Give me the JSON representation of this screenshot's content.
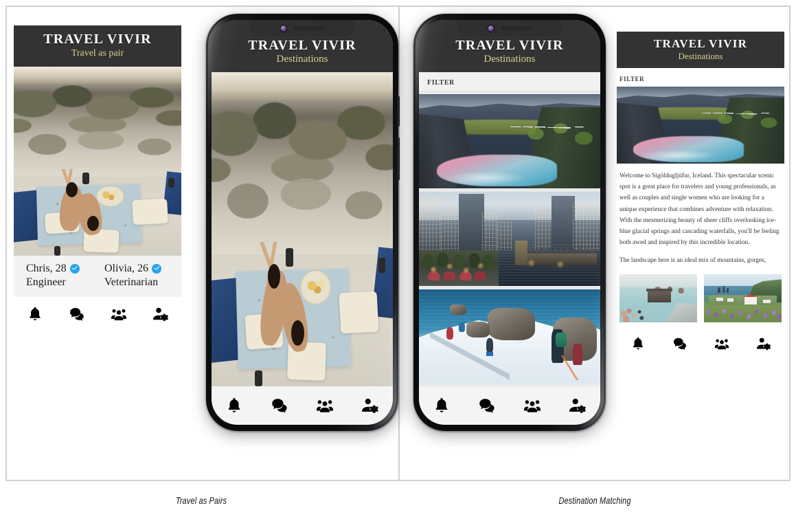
{
  "app": {
    "title": "TRAVEL VIVIR",
    "subtitle_pair": "Travel as pair",
    "subtitle_destinations": "Destinations",
    "filter_label": "FILTER",
    "brand_accent": "#d8cf8e",
    "header_bg": "#333333",
    "verified_color": "#2aa3ef"
  },
  "captions": {
    "left": "Travel as Pairs",
    "right": "Destination Matching"
  },
  "profiles": [
    {
      "name": "Chris, 28",
      "job": "Engineer",
      "verified": true
    },
    {
      "name": "Olivia, 26",
      "job": "Veterinarian",
      "verified": true
    }
  ],
  "nav": {
    "items": [
      {
        "icon": "bell-icon",
        "label": "Notifications"
      },
      {
        "icon": "chat-bubbles-icon",
        "label": "Messages"
      },
      {
        "icon": "people-group-icon",
        "label": "Groups"
      },
      {
        "icon": "person-settings-icon",
        "label": "Profile settings"
      }
    ]
  },
  "photos": {
    "couple_picnic": "Aerial view of a couple on a picnic blanket on a stone terrace by the sea",
    "canyon": "Sigoldugljufur canyon with waterfalls and a pink-teal river",
    "city_riverwalk": "City riverwalk with illuminated skyscrapers at dusk",
    "snow_ridge": "Mountaineers ascending a snowy ridge above a blue lake",
    "blue_lagoon": "Geothermal blue lagoon spa with bathers",
    "vik_lupines": "Coastal village church surrounded by purple lupine fields"
  },
  "feed": {
    "cards": [
      {
        "name": "canyon"
      },
      {
        "name": "city_riverwalk"
      },
      {
        "name": "snow_ridge"
      }
    ]
  },
  "detail": {
    "paragraph1": "Welcome to Sigöldugljúfur, Iceland. This spectacular scenic spot is a great place for travelers and young professionals, as well as couples and single women who are looking for a unique experience that combines adventure with relaxation. With the mesmerizing beauty of sheer cliffs overlooking ice-blue glacial springs and cascading waterfalls, you'll be feeling both awed and inspired by this incredible location.",
    "paragraph2": "The landscape here is an ideal mix of mountains, gorges,",
    "thumbnails": [
      {
        "name": "blue_lagoon"
      },
      {
        "name": "vik_lupines"
      }
    ]
  }
}
